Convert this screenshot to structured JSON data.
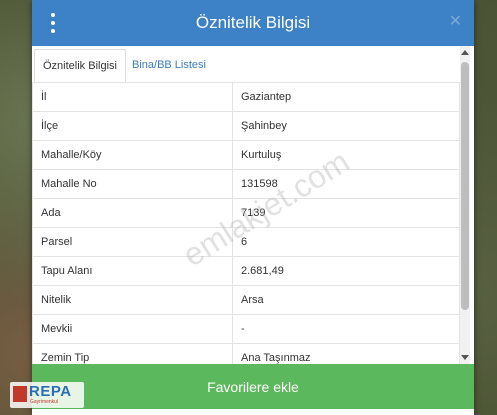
{
  "dialog": {
    "title": "Öznitelik Bilgisi",
    "close_symbol": "✕",
    "menu_icon": "kebab-menu-icon"
  },
  "tabs": [
    {
      "label": "Öznitelik Bilgisi",
      "active": true
    },
    {
      "label": "Bina/BB Listesi",
      "active": false
    }
  ],
  "attributes": [
    {
      "key": "İl",
      "value": "Gaziantep"
    },
    {
      "key": "İlçe",
      "value": "Şahinbey"
    },
    {
      "key": "Mahalle/Köy",
      "value": "Kurtuluş"
    },
    {
      "key": "Mahalle No",
      "value": "131598"
    },
    {
      "key": "Ada",
      "value": "7139"
    },
    {
      "key": "Parsel",
      "value": "6"
    },
    {
      "key": "Tapu Alanı",
      "value": "2.681,49"
    },
    {
      "key": "Nitelik",
      "value": "Arsa"
    },
    {
      "key": "Mevkii",
      "value": "-"
    },
    {
      "key": "Zemin Tip",
      "value": "Ana Taşınmaz"
    }
  ],
  "footer": {
    "favorite_label": "Favorilere ekle"
  },
  "watermark": "emlakjet.com",
  "logo": {
    "text": "REPA",
    "sub": "Gayrimenkul"
  },
  "colors": {
    "header": "#3d81c6",
    "button": "#5cb85c",
    "tab_link": "#3b7bbf"
  }
}
